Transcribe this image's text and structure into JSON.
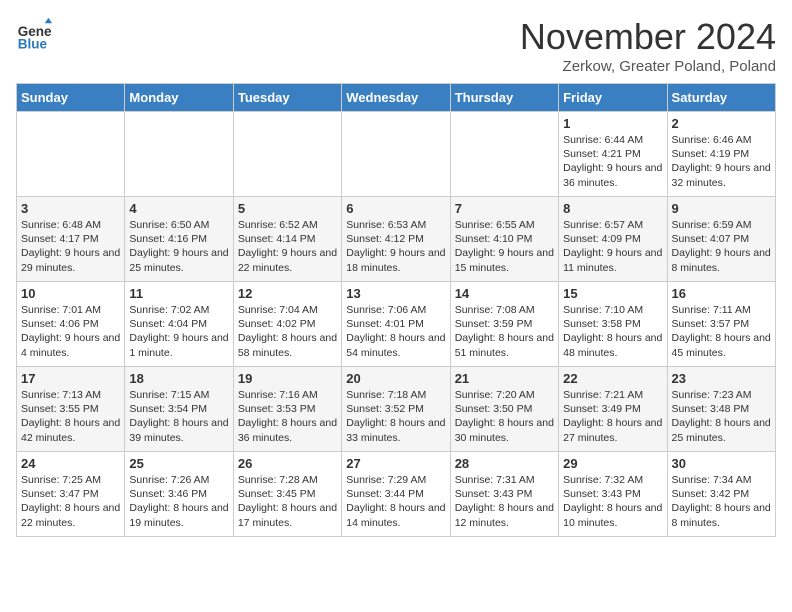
{
  "logo": {
    "general": "General",
    "blue": "Blue"
  },
  "title": {
    "month": "November 2024",
    "location": "Zerkow, Greater Poland, Poland"
  },
  "weekdays": [
    "Sunday",
    "Monday",
    "Tuesday",
    "Wednesday",
    "Thursday",
    "Friday",
    "Saturday"
  ],
  "weeks": [
    [
      {
        "day": "",
        "info": ""
      },
      {
        "day": "",
        "info": ""
      },
      {
        "day": "",
        "info": ""
      },
      {
        "day": "",
        "info": ""
      },
      {
        "day": "",
        "info": ""
      },
      {
        "day": "1",
        "info": "Sunrise: 6:44 AM\nSunset: 4:21 PM\nDaylight: 9 hours and 36 minutes."
      },
      {
        "day": "2",
        "info": "Sunrise: 6:46 AM\nSunset: 4:19 PM\nDaylight: 9 hours and 32 minutes."
      }
    ],
    [
      {
        "day": "3",
        "info": "Sunrise: 6:48 AM\nSunset: 4:17 PM\nDaylight: 9 hours and 29 minutes."
      },
      {
        "day": "4",
        "info": "Sunrise: 6:50 AM\nSunset: 4:16 PM\nDaylight: 9 hours and 25 minutes."
      },
      {
        "day": "5",
        "info": "Sunrise: 6:52 AM\nSunset: 4:14 PM\nDaylight: 9 hours and 22 minutes."
      },
      {
        "day": "6",
        "info": "Sunrise: 6:53 AM\nSunset: 4:12 PM\nDaylight: 9 hours and 18 minutes."
      },
      {
        "day": "7",
        "info": "Sunrise: 6:55 AM\nSunset: 4:10 PM\nDaylight: 9 hours and 15 minutes."
      },
      {
        "day": "8",
        "info": "Sunrise: 6:57 AM\nSunset: 4:09 PM\nDaylight: 9 hours and 11 minutes."
      },
      {
        "day": "9",
        "info": "Sunrise: 6:59 AM\nSunset: 4:07 PM\nDaylight: 9 hours and 8 minutes."
      }
    ],
    [
      {
        "day": "10",
        "info": "Sunrise: 7:01 AM\nSunset: 4:06 PM\nDaylight: 9 hours and 4 minutes."
      },
      {
        "day": "11",
        "info": "Sunrise: 7:02 AM\nSunset: 4:04 PM\nDaylight: 9 hours and 1 minute."
      },
      {
        "day": "12",
        "info": "Sunrise: 7:04 AM\nSunset: 4:02 PM\nDaylight: 8 hours and 58 minutes."
      },
      {
        "day": "13",
        "info": "Sunrise: 7:06 AM\nSunset: 4:01 PM\nDaylight: 8 hours and 54 minutes."
      },
      {
        "day": "14",
        "info": "Sunrise: 7:08 AM\nSunset: 3:59 PM\nDaylight: 8 hours and 51 minutes."
      },
      {
        "day": "15",
        "info": "Sunrise: 7:10 AM\nSunset: 3:58 PM\nDaylight: 8 hours and 48 minutes."
      },
      {
        "day": "16",
        "info": "Sunrise: 7:11 AM\nSunset: 3:57 PM\nDaylight: 8 hours and 45 minutes."
      }
    ],
    [
      {
        "day": "17",
        "info": "Sunrise: 7:13 AM\nSunset: 3:55 PM\nDaylight: 8 hours and 42 minutes."
      },
      {
        "day": "18",
        "info": "Sunrise: 7:15 AM\nSunset: 3:54 PM\nDaylight: 8 hours and 39 minutes."
      },
      {
        "day": "19",
        "info": "Sunrise: 7:16 AM\nSunset: 3:53 PM\nDaylight: 8 hours and 36 minutes."
      },
      {
        "day": "20",
        "info": "Sunrise: 7:18 AM\nSunset: 3:52 PM\nDaylight: 8 hours and 33 minutes."
      },
      {
        "day": "21",
        "info": "Sunrise: 7:20 AM\nSunset: 3:50 PM\nDaylight: 8 hours and 30 minutes."
      },
      {
        "day": "22",
        "info": "Sunrise: 7:21 AM\nSunset: 3:49 PM\nDaylight: 8 hours and 27 minutes."
      },
      {
        "day": "23",
        "info": "Sunrise: 7:23 AM\nSunset: 3:48 PM\nDaylight: 8 hours and 25 minutes."
      }
    ],
    [
      {
        "day": "24",
        "info": "Sunrise: 7:25 AM\nSunset: 3:47 PM\nDaylight: 8 hours and 22 minutes."
      },
      {
        "day": "25",
        "info": "Sunrise: 7:26 AM\nSunset: 3:46 PM\nDaylight: 8 hours and 19 minutes."
      },
      {
        "day": "26",
        "info": "Sunrise: 7:28 AM\nSunset: 3:45 PM\nDaylight: 8 hours and 17 minutes."
      },
      {
        "day": "27",
        "info": "Sunrise: 7:29 AM\nSunset: 3:44 PM\nDaylight: 8 hours and 14 minutes."
      },
      {
        "day": "28",
        "info": "Sunrise: 7:31 AM\nSunset: 3:43 PM\nDaylight: 8 hours and 12 minutes."
      },
      {
        "day": "29",
        "info": "Sunrise: 7:32 AM\nSunset: 3:43 PM\nDaylight: 8 hours and 10 minutes."
      },
      {
        "day": "30",
        "info": "Sunrise: 7:34 AM\nSunset: 3:42 PM\nDaylight: 8 hours and 8 minutes."
      }
    ]
  ]
}
